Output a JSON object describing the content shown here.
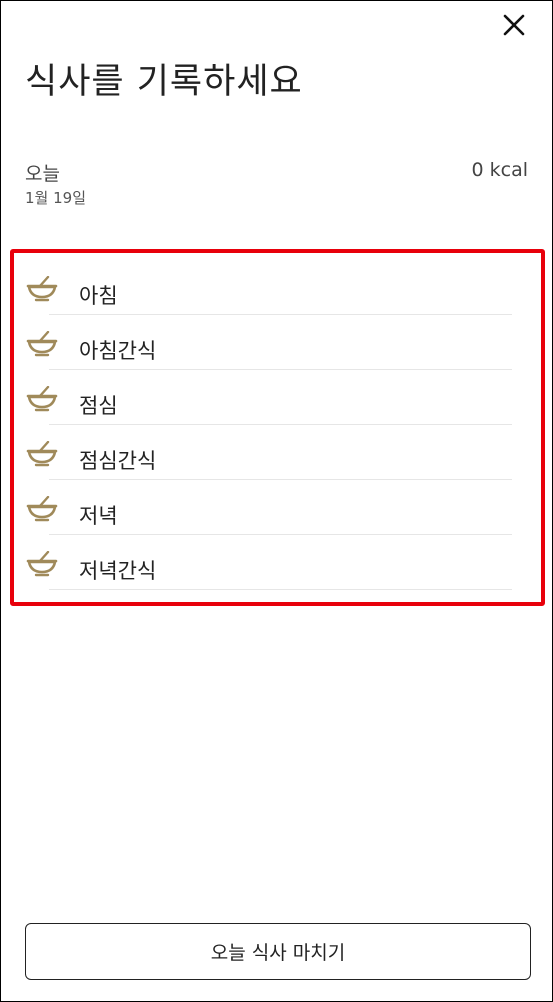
{
  "header": {
    "title": "식사를 기록하세요",
    "close_icon": "close-icon"
  },
  "summary": {
    "day_label": "오늘",
    "date": "1월 19일",
    "calories": "0 kcal"
  },
  "meals": {
    "icon": "bowl-icon",
    "icon_color": "#a08a5a",
    "items": [
      {
        "label": "아침"
      },
      {
        "label": "아침간식"
      },
      {
        "label": "점심"
      },
      {
        "label": "점심간식"
      },
      {
        "label": "저녁"
      },
      {
        "label": "저녁간식"
      }
    ]
  },
  "footer": {
    "finish_label": "오늘 식사 마치기"
  },
  "colors": {
    "highlight": "#e8000b",
    "text": "#222222"
  }
}
